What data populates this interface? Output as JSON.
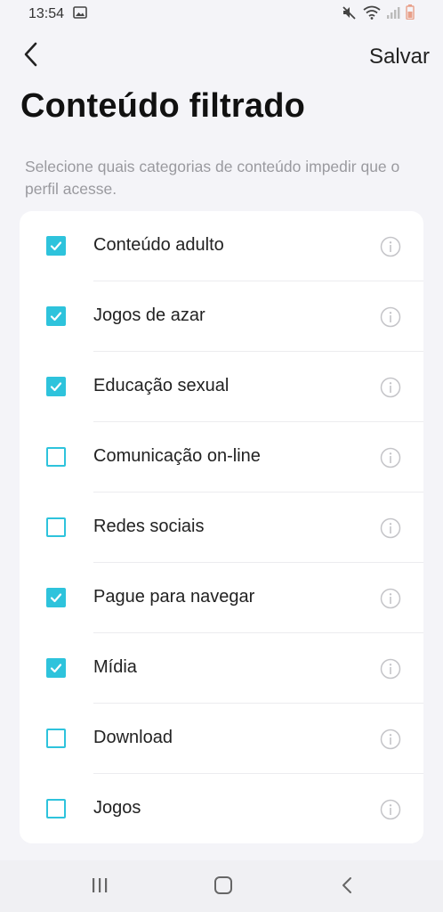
{
  "status_bar": {
    "time": "13:54",
    "icons": [
      "image-notification-icon",
      "mute-icon",
      "wifi-icon",
      "signal-icon",
      "battery-icon"
    ]
  },
  "header": {
    "back_icon": "chevron-left-icon",
    "save_label": "Salvar"
  },
  "page": {
    "title": "Conteúdo filtrado",
    "description": "Selecione quais categorias de conteúdo impedir que o perfil acesse."
  },
  "categories": [
    {
      "label": "Conteúdo adulto",
      "checked": true
    },
    {
      "label": "Jogos de azar",
      "checked": true
    },
    {
      "label": "Educação sexual",
      "checked": true
    },
    {
      "label": "Comunicação on-line",
      "checked": false
    },
    {
      "label": "Redes sociais",
      "checked": false
    },
    {
      "label": "Pague para navegar",
      "checked": true
    },
    {
      "label": "Mídia",
      "checked": true
    },
    {
      "label": "Download",
      "checked": false
    },
    {
      "label": "Jogos",
      "checked": false
    }
  ],
  "nav_bar": {
    "icons": [
      "recent-apps-icon",
      "home-icon",
      "back-icon"
    ]
  },
  "colors": {
    "accent": "#2ec3dc",
    "background": "#f4f4f8",
    "card": "#ffffff",
    "muted_text": "#9a9a9f"
  }
}
